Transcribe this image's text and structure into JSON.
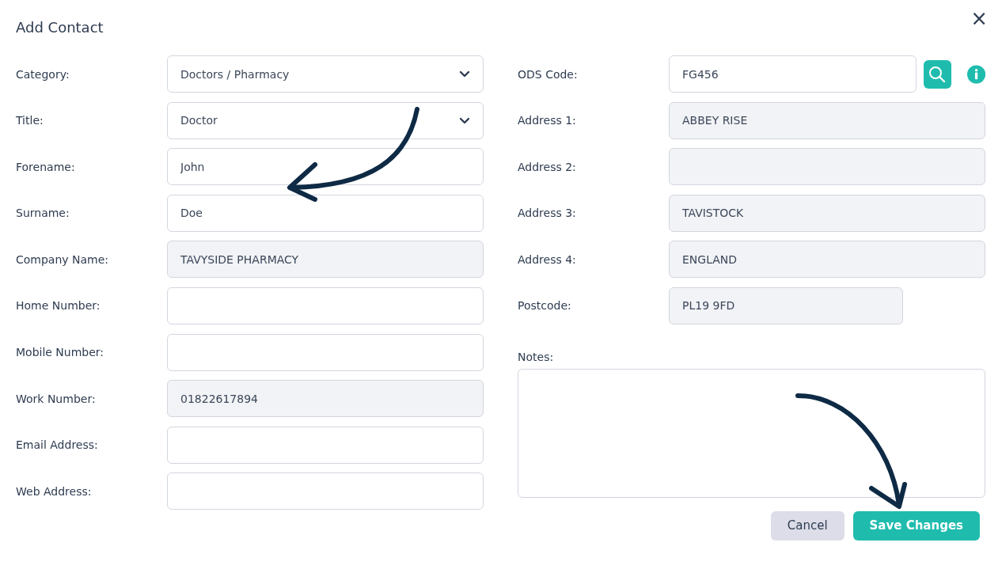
{
  "dialog": {
    "title": "Add Contact",
    "close": "×"
  },
  "left_fields": [
    {
      "label": "Category:",
      "kind": "select",
      "value": "Doctors / Pharmacy",
      "disabled": false
    },
    {
      "label": "Title:",
      "kind": "select",
      "value": "Doctor",
      "disabled": false
    },
    {
      "label": "Forename:",
      "kind": "text",
      "value": "John",
      "disabled": false
    },
    {
      "label": "Surname:",
      "kind": "text",
      "value": "Doe",
      "disabled": false
    },
    {
      "label": "Company Name:",
      "kind": "text",
      "value": "TAVYSIDE PHARMACY",
      "disabled": true
    },
    {
      "label": "Home Number:",
      "kind": "text",
      "disabled": false
    },
    {
      "label": "Mobile Number:",
      "kind": "text",
      "disabled": false
    },
    {
      "label": "Work Number:",
      "kind": "text",
      "value": "01822617894",
      "disabled": true
    },
    {
      "label": "Email Address:",
      "kind": "text",
      "disabled": false
    },
    {
      "label": "Web Address:",
      "kind": "text",
      "disabled": false
    }
  ],
  "right_fields": [
    {
      "label": "ODS Code:",
      "kind": "lookup",
      "value": "FG456",
      "disabled": false
    },
    {
      "label": "Address 1:",
      "kind": "text",
      "value": "ABBEY RISE",
      "disabled": true
    },
    {
      "label": "Address 2:",
      "kind": "text",
      "disabled": true
    },
    {
      "label": "Address 3:",
      "kind": "text",
      "value": "TAVISTOCK",
      "disabled": true
    },
    {
      "label": "Address 4:",
      "kind": "text",
      "value": "ENGLAND",
      "disabled": true
    },
    {
      "label": "Postcode:",
      "kind": "short",
      "value": "PL19 9FD",
      "disabled": true
    }
  ],
  "notes": {
    "label": "Notes:"
  },
  "buttons": [
    {
      "label": "Cancel",
      "kind": "secondary"
    },
    {
      "label": "Save Changes",
      "kind": "primary"
    }
  ]
}
